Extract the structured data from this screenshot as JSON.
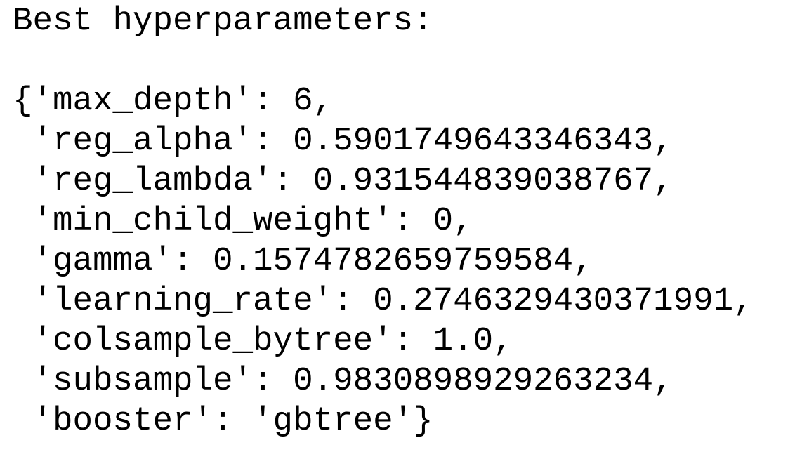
{
  "output": {
    "heading": "Best hyperparameters:",
    "lines": [
      "{'max_depth': 6,",
      " 'reg_alpha': 0.5901749643346343,",
      " 'reg_lambda': 0.931544839038767,",
      " 'min_child_weight': 0,",
      " 'gamma': 0.1574782659759584,",
      " 'learning_rate': 0.2746329430371991,",
      " 'colsample_bytree': 1.0,",
      " 'subsample': 0.9830898929263234,",
      " 'booster': 'gbtree'}"
    ]
  }
}
